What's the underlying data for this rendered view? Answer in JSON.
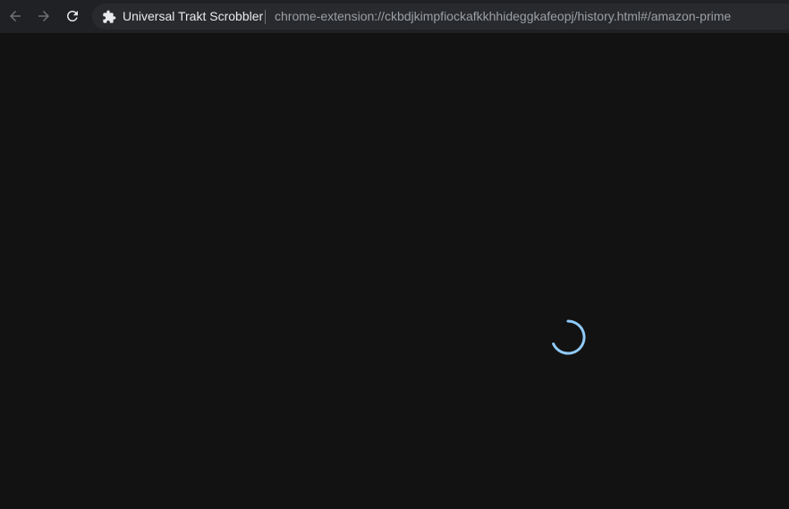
{
  "browser": {
    "site_name": "Universal Trakt Scrobbler",
    "url": "chrome-extension://ckbdjkimpfiockafkkhhideggkafeopj/history.html#/amazon-prime",
    "icons": {
      "back": "arrow-left-icon",
      "forward": "arrow-right-icon",
      "reload": "reload-icon",
      "site": "puzzle-piece-icon"
    }
  },
  "page": {
    "loading_indicator": {
      "color": "#90caf9",
      "state": "loading"
    }
  },
  "colors": {
    "toolbar_bg": "#202124",
    "omnibox_bg": "#292a2d",
    "page_bg": "#121212"
  }
}
